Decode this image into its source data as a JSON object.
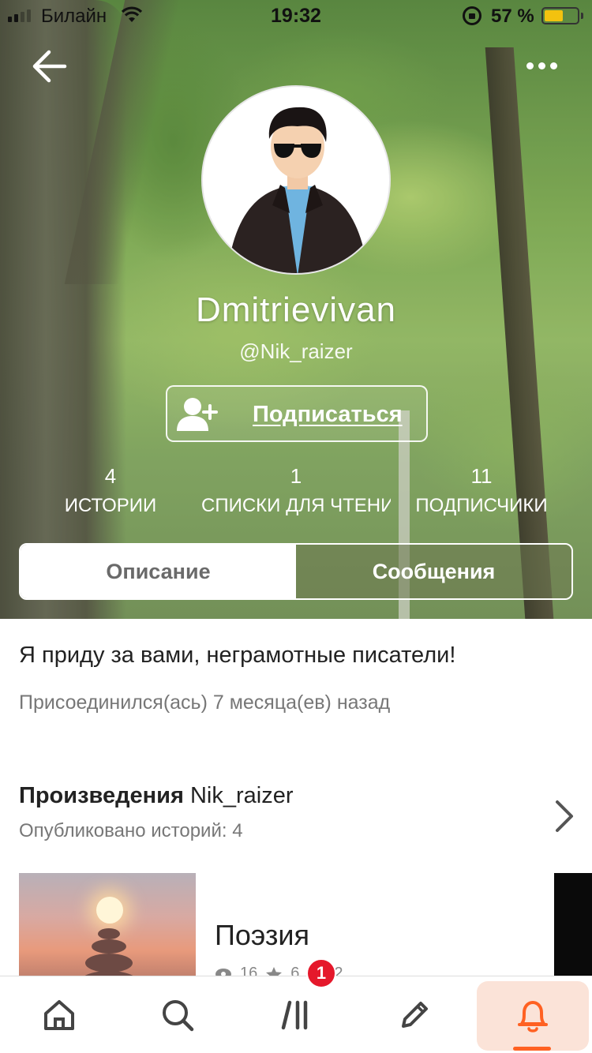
{
  "status_bar": {
    "carrier": "Билайн",
    "time": "19:32",
    "battery_text": "57 %",
    "battery_level": 0.57
  },
  "profile": {
    "display_name": "Dmitrievivan",
    "username": "@Nik_raizer",
    "follow_label": "Подписаться"
  },
  "stats": [
    {
      "value": "4",
      "label": "ИСТОРИИ"
    },
    {
      "value": "1",
      "label": "СПИСКИ ДЛЯ ЧТЕНИЯ"
    },
    {
      "value": "11",
      "label": "ПОДПИСЧИКИ"
    }
  ],
  "tabs": {
    "about": "Описание",
    "messages": "Сообщения"
  },
  "about": {
    "bio": "Я приду за вами, неграмотные писатели!",
    "joined": "Присоединился(ась) 7 месяца(ев) назад"
  },
  "works": {
    "title_bold": "Произведения",
    "title_user": "Nik_raizer",
    "count_text": "Опубликовано историй: 4",
    "stories": [
      {
        "title": "Поэзия",
        "reads": "16",
        "votes": "6",
        "parts": "2"
      }
    ]
  },
  "bottom_nav": {
    "badge_count": "1",
    "items": [
      "home-icon",
      "search-icon",
      "library-icon",
      "write-icon",
      "notifications-icon"
    ],
    "active": "notifications-icon",
    "accent": "#ff6122"
  }
}
